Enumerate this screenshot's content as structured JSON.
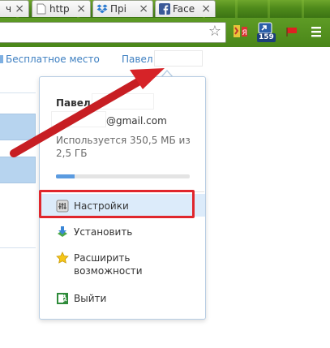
{
  "tabs": [
    {
      "label": "ч",
      "favicon": "page-icon"
    },
    {
      "label": "http",
      "favicon": "page-icon"
    },
    {
      "label": "Прі",
      "favicon": "dropbox-icon"
    },
    {
      "label": "Face",
      "favicon": "facebook-icon"
    }
  ],
  "toolbar": {
    "badge_count": "159"
  },
  "page": {
    "free_space_link": "Бесплатное место",
    "account_link": "Павел"
  },
  "menu": {
    "user_name": "Павел",
    "email_suffix": "@gmail.com",
    "usage_text": "Используется 350,5 МБ из 2,5 ГБ",
    "usage_fraction": 0.14,
    "items": [
      {
        "label": "Настройки",
        "icon": "settings-icon"
      },
      {
        "label": "Установить",
        "icon": "install-icon"
      },
      {
        "label": "Расширить возможности",
        "icon": "star-icon"
      },
      {
        "label": "Выйти",
        "icon": "exit-icon"
      }
    ]
  },
  "colors": {
    "accent_link": "#3d7fc1",
    "highlight_red": "#e0262c",
    "progress_blue": "#5b9be0"
  }
}
